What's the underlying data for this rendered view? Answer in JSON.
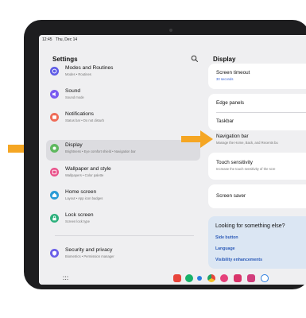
{
  "status_bar": {
    "time": "12:45",
    "date": "Thu, Dec 14"
  },
  "settings": {
    "title": "Settings",
    "items": [
      {
        "key": "modes",
        "title": "Modes and Routines",
        "subtitle": "Modes • Routines",
        "color": "#5e5ce6",
        "icon": "modes-icon"
      },
      {
        "key": "sound",
        "title": "Sound",
        "subtitle": "Sound mode",
        "color": "#7a5cf0",
        "icon": "speaker-icon"
      },
      {
        "key": "notifications",
        "title": "Notifications",
        "subtitle": "Status bar • Do not disturb",
        "color": "#ef6b57",
        "icon": "bell-icon"
      },
      {
        "key": "display",
        "title": "Display",
        "subtitle": "Brightness • Eye comfort shield • Navigation bar",
        "color": "#5fb85f",
        "icon": "sun-icon",
        "selected": true
      },
      {
        "key": "wallpaper",
        "title": "Wallpaper and style",
        "subtitle": "Wallpapers • Color palette",
        "color": "#e9528a",
        "icon": "wallpaper-icon"
      },
      {
        "key": "home",
        "title": "Home screen",
        "subtitle": "Layout • App icon badges",
        "color": "#2a9bd6",
        "icon": "home-icon"
      },
      {
        "key": "lock",
        "title": "Lock screen",
        "subtitle": "Screen lock type",
        "color": "#2db07c",
        "icon": "lock-icon"
      },
      {
        "key": "security",
        "title": "Security and privacy",
        "subtitle": "Biometrics • Permission manager",
        "color": "#6a5fe8",
        "icon": "shield-icon"
      }
    ]
  },
  "display": {
    "title": "Display",
    "screen_timeout": {
      "title": "Screen timeout",
      "value": "30 seconds"
    },
    "edge_panels": "Edge panels",
    "taskbar": "Taskbar",
    "navigation_bar": {
      "title": "Navigation bar",
      "subtitle": "Manage the Home, Back, and Recents bu"
    },
    "touch_sensitivity": {
      "title": "Touch sensitivity",
      "subtitle": "Increase the touch sensitivity of the scre"
    },
    "screen_saver": "Screen saver",
    "suggestions": {
      "heading": "Looking for something else?",
      "links": [
        "Side button",
        "Language",
        "Visibility enhancements"
      ]
    }
  },
  "dock_apps": [
    {
      "icon": "app-red-icon",
      "color": "#e8453c"
    },
    {
      "icon": "app-green-icon",
      "color": "#17b26a"
    },
    {
      "icon": "app-chat-icon",
      "color": "#2a7de1"
    },
    {
      "icon": "app-chrome-icon",
      "color": "#3f8fe8"
    },
    {
      "icon": "app-flower-icon",
      "color": "#e5407a"
    },
    {
      "icon": "app-gallery-icon",
      "color": "#d9346a"
    },
    {
      "icon": "app-gear-icon",
      "color": "#d13d7c"
    },
    {
      "icon": "app-camera-icon",
      "color": "#ffffff"
    }
  ],
  "colors": {
    "arrow": "#f5a623",
    "link": "#2c5bb8",
    "selected_bg": "#dcdce0"
  }
}
